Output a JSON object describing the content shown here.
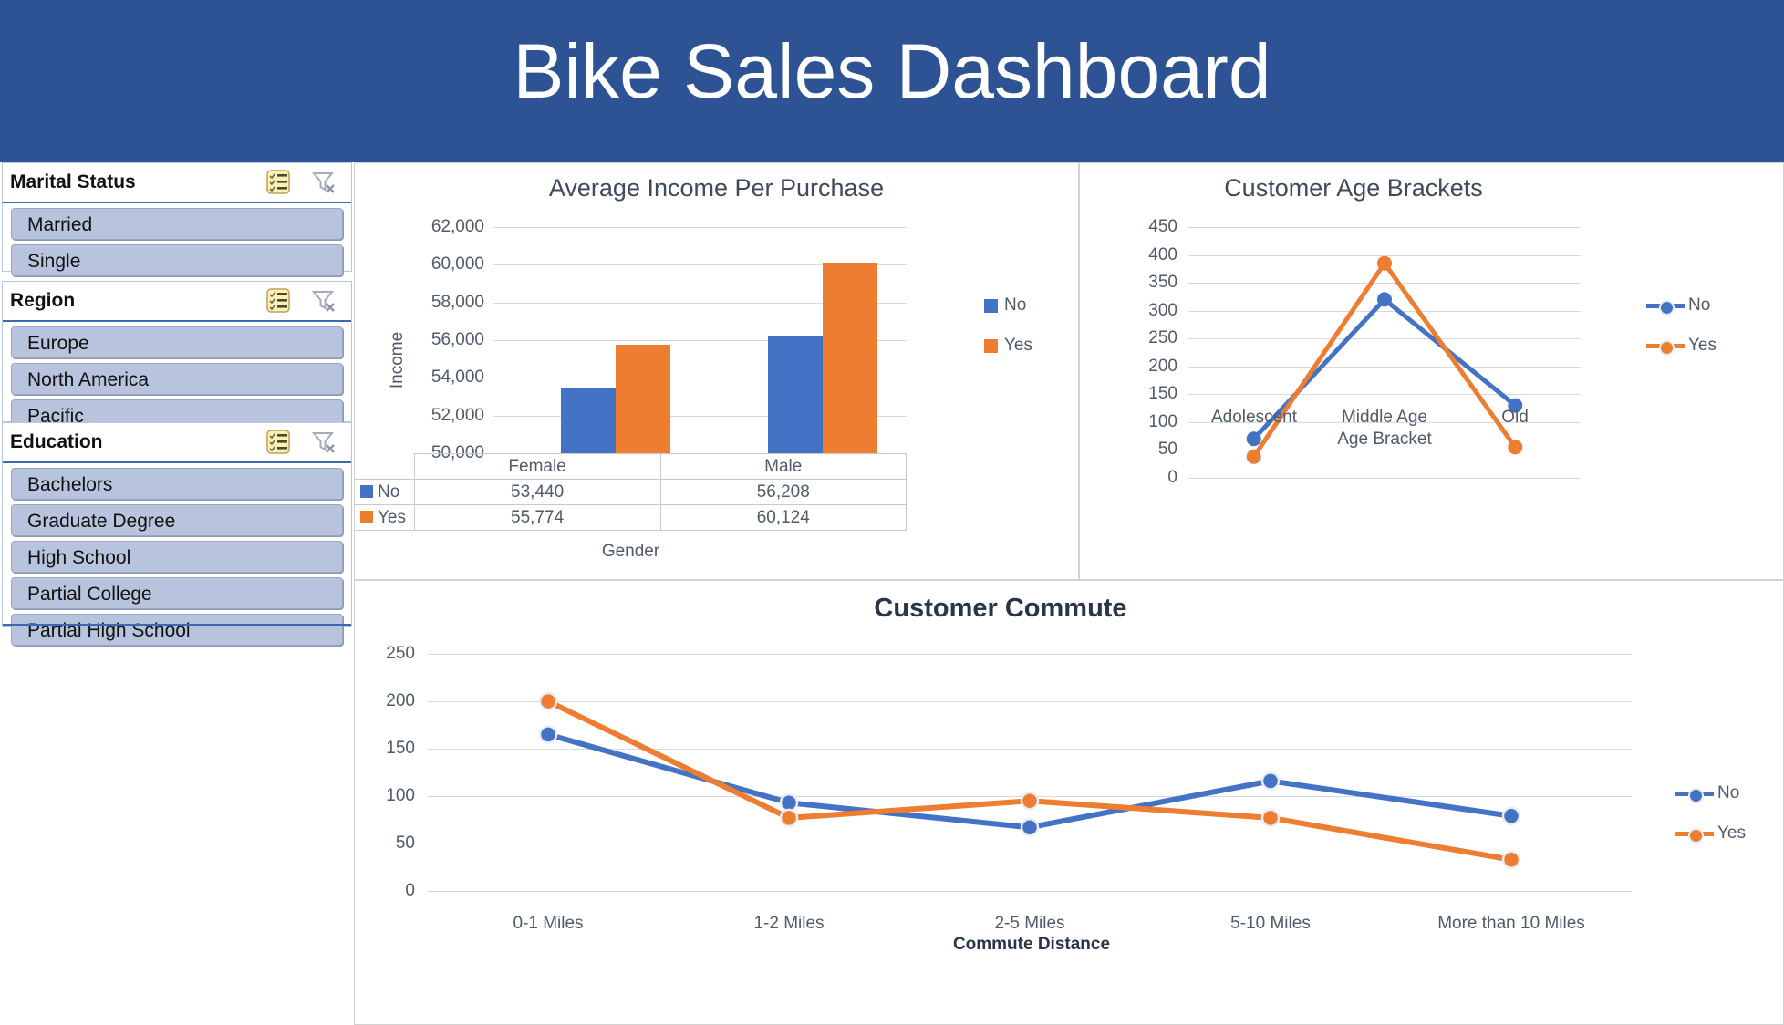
{
  "header": {
    "title": "Bike Sales Dashboard",
    "background": "#2D5394"
  },
  "colors": {
    "series_no": "#4472c4",
    "series_yes": "#ed7d31",
    "banner": "#2D5394",
    "slicer_item": "#b8c4de"
  },
  "slicers": [
    {
      "title": "Marital Status",
      "multiselect_icon": "multi-select-icon",
      "clear_icon": "clear-filter-icon",
      "items": [
        "Married",
        "Single"
      ]
    },
    {
      "title": "Region",
      "multiselect_icon": "multi-select-icon",
      "clear_icon": "clear-filter-icon",
      "items": [
        "Europe",
        "North America",
        "Pacific"
      ]
    },
    {
      "title": "Education",
      "multiselect_icon": "multi-select-icon",
      "clear_icon": "clear-filter-icon",
      "items": [
        "Bachelors",
        "Graduate Degree",
        "High School",
        "Partial College",
        "Partial High School"
      ]
    }
  ],
  "chart_data": [
    {
      "id": "income",
      "type": "bar",
      "title": "Average Income Per Purchase",
      "xlabel": "Gender",
      "ylabel": "Income",
      "categories": [
        "Female",
        "Male"
      ],
      "series": [
        {
          "name": "No",
          "color": "#4472c4",
          "values": [
            53440,
            55774
          ]
        },
        {
          "name": "Yes",
          "color": "#ed7d31",
          "values": [
            55774,
            60124
          ]
        }
      ],
      "data_table": {
        "row_labels": [
          "No",
          "Yes"
        ],
        "columns": [
          "Female",
          "Male"
        ],
        "rows": [
          [
            "53,440",
            "56,208"
          ],
          [
            "55,774",
            "60,124"
          ]
        ]
      },
      "ylim": [
        50000,
        62000
      ],
      "yticks": [
        "50,000",
        "52,000",
        "54,000",
        "56,000",
        "58,000",
        "60,000",
        "62,000"
      ],
      "legend": [
        "No",
        "Yes"
      ],
      "legend_position": "right",
      "grid": true
    },
    {
      "id": "age",
      "type": "line",
      "title": "Customer Age Brackets",
      "xlabel": "Age Bracket",
      "ylabel": "",
      "categories": [
        "Adolescent",
        "Middle Age",
        "Old"
      ],
      "series": [
        {
          "name": "No",
          "color": "#4472c4",
          "values": [
            70,
            320,
            130
          ]
        },
        {
          "name": "Yes",
          "color": "#ed7d31",
          "values": [
            38,
            385,
            55
          ]
        }
      ],
      "ylim": [
        0,
        450
      ],
      "yticks": [
        "0",
        "50",
        "100",
        "150",
        "200",
        "250",
        "300",
        "350",
        "400",
        "450"
      ],
      "legend": [
        "No",
        "Yes"
      ],
      "legend_position": "right",
      "grid": true
    },
    {
      "id": "commute",
      "type": "line",
      "title": "Customer Commute",
      "xlabel": "Commute Distance",
      "ylabel": "",
      "categories": [
        "0-1 Miles",
        "1-2 Miles",
        "2-5 Miles",
        "5-10 Miles",
        "More than 10 Miles"
      ],
      "series": [
        {
          "name": "No",
          "color": "#4472c4",
          "values": [
            165,
            93,
            67,
            116,
            79
          ]
        },
        {
          "name": "Yes",
          "color": "#ed7d31",
          "values": [
            200,
            77,
            95,
            77,
            33
          ]
        }
      ],
      "ylim": [
        0,
        250
      ],
      "yticks": [
        "0",
        "50",
        "100",
        "150",
        "200",
        "250"
      ],
      "legend": [
        "No",
        "Yes"
      ],
      "legend_position": "right",
      "grid": true
    }
  ]
}
